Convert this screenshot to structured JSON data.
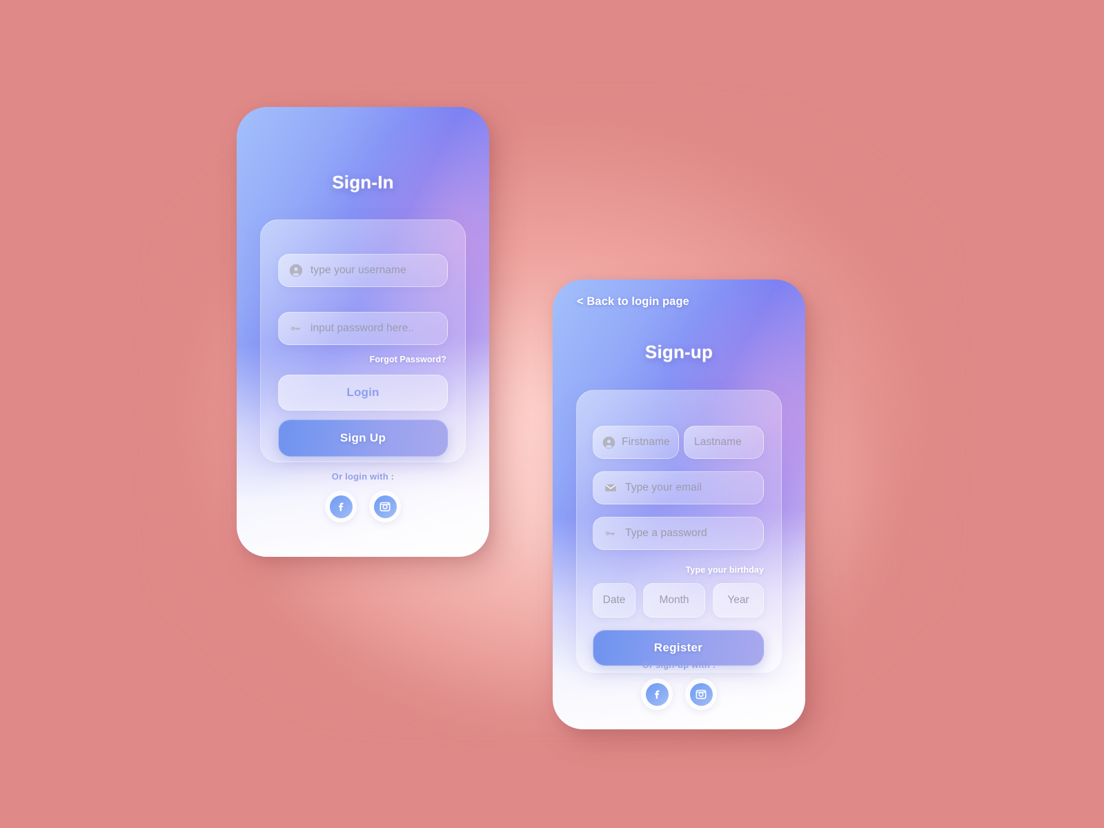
{
  "background": {
    "color": "#df8a88",
    "glow_color": "#ffd6d0"
  },
  "theme": {
    "accent_blue": "#7b83f5",
    "button_blue": "#6f93ef",
    "link_blue": "#8e9eee",
    "placeholder_gray": "#9d9bab",
    "card_top": "#a3c0fb",
    "card_bottom": "#ffffff"
  },
  "signin": {
    "title": "Sign-In",
    "username": {
      "placeholder": "type your username",
      "value": "",
      "icon": "person-icon"
    },
    "password": {
      "placeholder": "input password here..",
      "value": "",
      "icon": "key-icon"
    },
    "forgot_password_label": "Forgot Password?",
    "login_label": "Login",
    "signup_label": "Sign Up",
    "social_label": "Or login with  :",
    "social": [
      {
        "name": "facebook",
        "icon": "facebook-icon"
      },
      {
        "name": "instagram",
        "icon": "instagram-icon"
      }
    ]
  },
  "signup": {
    "back_label": "< Back to login page",
    "title": "Sign-up",
    "firstname": {
      "placeholder": "Firstname",
      "value": "",
      "icon": "person-icon"
    },
    "lastname": {
      "placeholder": "Lastname",
      "value": ""
    },
    "email": {
      "placeholder": "Type your email",
      "value": "",
      "icon": "mail-icon"
    },
    "password": {
      "placeholder": "Type  a password",
      "value": "",
      "icon": "key-icon"
    },
    "birthday_label": "Type your birthday",
    "birthday": {
      "date_placeholder": "Date",
      "month_placeholder": "Month",
      "year_placeholder": "Year"
    },
    "register_label": "Register",
    "social_label": "Or sign-up with :",
    "social": [
      {
        "name": "facebook",
        "icon": "facebook-icon"
      },
      {
        "name": "instagram",
        "icon": "instagram-icon"
      }
    ]
  }
}
